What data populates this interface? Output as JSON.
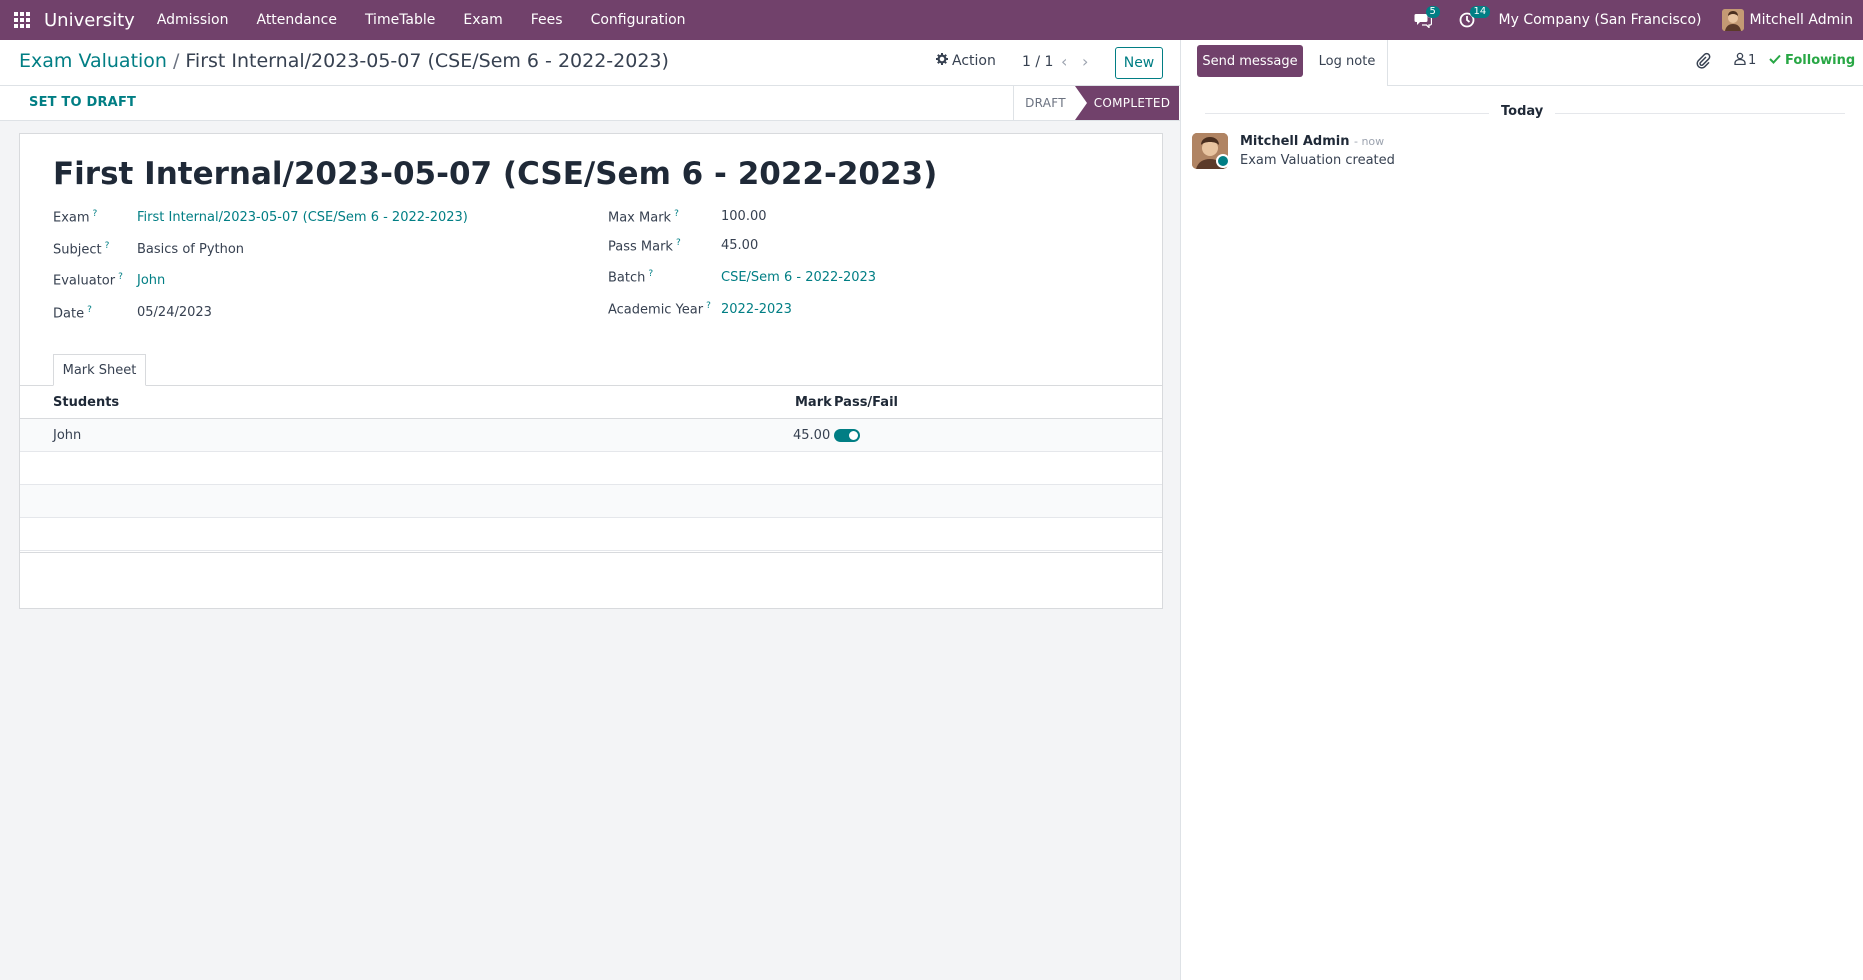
{
  "nav": {
    "brand": "University",
    "menu": [
      "Admission",
      "Attendance",
      "TimeTable",
      "Exam",
      "Fees",
      "Configuration"
    ],
    "messages_count": "5",
    "activities_count": "14",
    "company": "My Company (San Francisco)",
    "user": "Mitchell Admin"
  },
  "control": {
    "breadcrumb_parent": "Exam Valuation",
    "breadcrumb_sep": "/",
    "breadcrumb_current": "First Internal/2023-05-07 (CSE/Sem 6 - 2022-2023)",
    "action_label": "Action",
    "pager": "1 / 1",
    "new_label": "New"
  },
  "status": {
    "set_to_draft": "SET TO DRAFT",
    "stages": [
      "DRAFT",
      "COMPLETED"
    ],
    "current_stage": "COMPLETED"
  },
  "form": {
    "title": "First Internal/2023-05-07 (CSE/Sem 6 - 2022-2023)",
    "left_fields": [
      {
        "label": "Exam",
        "value": "First Internal/2023-05-07 (CSE/Sem 6 - 2022-2023)"
      },
      {
        "label": "Subject",
        "value": "Basics of Python"
      },
      {
        "label": "Evaluator",
        "value": "John"
      },
      {
        "label": "Date",
        "value": "05/24/2023"
      }
    ],
    "right_fields": [
      {
        "label": "Max Mark",
        "value": "100.00"
      },
      {
        "label": "Pass Mark",
        "value": "45.00"
      },
      {
        "label": "Batch",
        "value": "CSE/Sem 6 - 2022-2023"
      },
      {
        "label": "Academic Year",
        "value": "2022-2023"
      }
    ],
    "help_mark": "?",
    "tab": "Mark Sheet",
    "columns": {
      "students": "Students",
      "mark": "Mark",
      "pass_fail": "Pass/Fail"
    },
    "rows": [
      {
        "student": "John",
        "mark": "45.00",
        "pass": true
      }
    ]
  },
  "chatter": {
    "send_message": "Send message",
    "log_note": "Log note",
    "followers_count": "1",
    "following": "Following",
    "date_separator": "Today",
    "messages": [
      {
        "author": "Mitchell Admin",
        "time": "- now",
        "body": "Exam Valuation created"
      }
    ]
  },
  "colors": {
    "brand": "#71416b",
    "accent": "#017e84",
    "success": "#28a745"
  }
}
